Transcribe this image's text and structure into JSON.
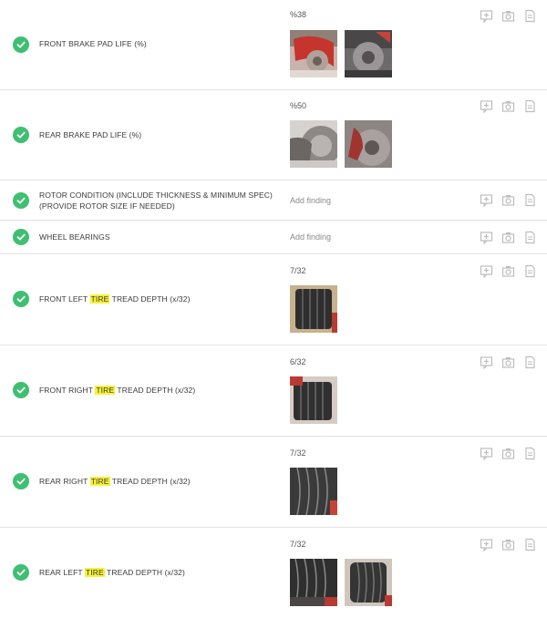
{
  "items": [
    {
      "label_parts": [
        "FRONT BRAKE PAD LIFE (%)"
      ],
      "value": "%38",
      "photos": [
        "brake-caliper-red",
        "brake-rotor"
      ]
    },
    {
      "label_parts": [
        "REAR BRAKE PAD LIFE (%)"
      ],
      "value": "%50",
      "photos": [
        "rear-brake-rotor",
        "rear-brake-pad"
      ]
    },
    {
      "label_parts": [
        "ROTOR CONDITION (INCLUDE THICKNESS & MINIMUM SPEC)",
        "(PROVIDE ROTOR SIZE IF NEEDED)"
      ],
      "finding_placeholder": "Add finding"
    },
    {
      "label_parts": [
        "WHEEL BEARINGS"
      ],
      "finding_placeholder": "Add finding"
    },
    {
      "label_parts": [
        "FRONT LEFT ",
        "TIRE",
        " TREAD DEPTH (x/32)"
      ],
      "value": "7/32",
      "photos": [
        "tire-tread-front-left"
      ]
    },
    {
      "label_parts": [
        "FRONT RIGHT ",
        "TIRE",
        " TREAD DEPTH (x/32)"
      ],
      "value": "6/32",
      "photos": [
        "tire-tread-front-right"
      ]
    },
    {
      "label_parts": [
        "REAR RIGHT ",
        "TIRE",
        " TREAD DEPTH (x/32)"
      ],
      "value": "7/32",
      "photos": [
        "tire-tread-rear-right"
      ]
    },
    {
      "label_parts": [
        "REAR LEFT ",
        "TIRE",
        " TREAD DEPTH (x/32)"
      ],
      "value": "7/32",
      "photos": [
        "tire-tread-rear-left-1",
        "tire-tread-rear-left-2"
      ]
    }
  ],
  "action_icons": [
    "comment-icon",
    "camera-icon",
    "document-icon"
  ],
  "colors": {
    "check": "#3fbf72",
    "highlight": "#f6f138",
    "divider": "#e3e3e3"
  }
}
